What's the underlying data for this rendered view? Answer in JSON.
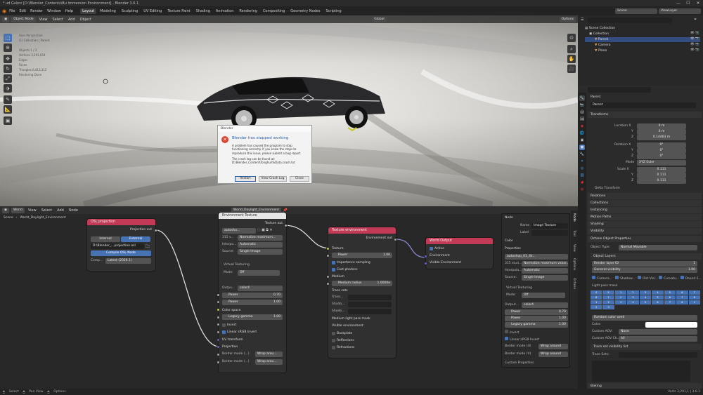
{
  "titlebar": {
    "text": "* ud Gubnr  [D:\\Blender_Contents\\Bu Immersion Environment]  -  Blender 3.6.1",
    "min": "—",
    "max": "☐",
    "close": "✕"
  },
  "menus": [
    "File",
    "Edit",
    "Render",
    "Window",
    "Help"
  ],
  "workspaces": [
    "Layout",
    "Modeling",
    "Sculpting",
    "UV Editing",
    "Texture Paint",
    "Shading",
    "Animation",
    "Rendering",
    "Compositing",
    "Geometry Nodes",
    "Scripting"
  ],
  "scene": {
    "label": "Scene",
    "viewlayer": "ViewLayer"
  },
  "viewport": {
    "mode": "Object Mode",
    "menus": [
      "View",
      "Select",
      "Add",
      "Object"
    ],
    "orientation": "Global",
    "options": "Options",
    "overlay_lines": [
      "User Perspective",
      "(1) Collection | Parent",
      "Objects   1 / 3",
      "Vertices  3,291,654",
      "Edges",
      "Faces",
      "Triangles  6,413,312",
      "Rendering Done"
    ]
  },
  "dialog": {
    "title": "Blender",
    "heading": "Blender has stopped working",
    "body": "A problem has caused the program to stop functioning correctly. If you know the steps to reproduce this issue, please submit a bug report.",
    "crash": "The crash log can be found at: D:\\Blender_Content\\Tonghui\\%Data.crash.txt",
    "restart": "Restart",
    "view": "View Crash Log",
    "close": "Close"
  },
  "node_editor": {
    "type": "World",
    "menus": [
      "View",
      "Select",
      "Add",
      "Node"
    ],
    "world_name": "World_Daylight_Environment",
    "crumb_scene": "Scene",
    "crumb_world": "World_Daylight_Environment"
  },
  "ocio": {
    "title": "OSL projection",
    "out": "Projection out",
    "internal": "Internal",
    "external": "External",
    "path": "D:\\Blender_...projection.osl",
    "compile": "Compile OSL Node",
    "comp_lbl": "Comp...",
    "comp_val": "Latest (2026.1)"
  },
  "envtex": {
    "title": "Environment Texture",
    "filename": "World_Daylight_environment",
    "out": "Texture out",
    "imgname": "autosho...",
    "colorspace_lbl": "315 s...",
    "colorspace": "Normalize maximum...",
    "interp_lbl": "Interpo...",
    "interp": "Automatic",
    "source_lbl": "Source:",
    "source": "Single Image",
    "vt": "Virtual Texturing",
    "mode_lbl": "Mode:",
    "mode": "Off",
    "output_lbl": "Outpu...",
    "output": "color4",
    "power1": "Power",
    "power1_v": "0.70",
    "power2": "Power",
    "power2_v": "1.00",
    "colorspace2": "Color space",
    "legacy": "Legacy gamma",
    "legacy_v": "1.00",
    "invert": "Invert",
    "linear": "Linear sRGB Invert",
    "uv": "UV transform",
    "proj": "Projection",
    "border1": "Border mode (...)",
    "border1_v": "Wrap arou...",
    "border2": "Border mode (...)",
    "border2_v": "Wrap arou..."
  },
  "texenv": {
    "title": "Texture environment",
    "out": "Environment out",
    "texture": "Texture",
    "power": "Power",
    "power_v": "1.00",
    "importance": "Importance sampling",
    "cast": "Cast photons",
    "medium": "Medium",
    "medium_radius": "Medium radius",
    "medium_radius_v": "1.0000e",
    "trace": "Trace sets",
    "tr1": "Trace...",
    "tr2": "Shado...",
    "tr3": "Shado...",
    "medlight": "Medium light pass mask",
    "visible": "Visible environment",
    "backplate": "Backplate",
    "reflections": "Reflections",
    "refractions": "Refractions"
  },
  "worldout": {
    "title": "World Output",
    "active": "Active",
    "env": "Environment",
    "visenv": "Visible Environment"
  },
  "npanel": {
    "node_hdr": "Node",
    "name_lbl": "Name",
    "name": "Image Texture",
    "label_lbl": "Label",
    "color_hdr": "Color",
    "props_hdr": "Properties",
    "img": "autoshop_01_4k...",
    "cs_lbl": "315 stud...",
    "cs": "Normalize maximum value...",
    "interp_lbl": "Interpola...",
    "interp": "Automatic",
    "source_lbl": "Source:",
    "source": "Single Image",
    "vt": "Virtual Texturing",
    "mode_lbl": "Mode:",
    "mode": "Off",
    "out_lbl": "Output...",
    "out": "color4",
    "p1": "Power",
    "p1v": "0.70",
    "p2": "Power",
    "p2v": "1.00",
    "lg": "Legacy gamma",
    "lgv": "1.00",
    "inv": "Invert",
    "lin": "Linear sRGB Invert",
    "bm1": "Border mode (U)",
    "bm1v": "Wrap around",
    "bm2": "Border mode (V)",
    "bm2v": "Wrap around",
    "custom": "Custom Properties"
  },
  "vtabs": [
    "Node",
    "Tool",
    "View",
    "Options",
    "Octane"
  ],
  "outliner": {
    "search": "",
    "items": [
      {
        "name": "Scene Collection",
        "indent": 0
      },
      {
        "name": "Collection",
        "indent": 1
      },
      {
        "name": "Parent",
        "indent": 2,
        "selected": true
      },
      {
        "name": "Camera",
        "indent": 2
      },
      {
        "name": "Plane",
        "indent": 2
      }
    ]
  },
  "properties": {
    "obj_name": "Parent",
    "obj_field": "Parent",
    "transforms": "Transforms",
    "loc_x": "0 m",
    "loc_y": "0 m",
    "loc_z": "0.14463 m",
    "rot_x": "0°",
    "rot_y": "0°",
    "rot_z": "0°",
    "rot_mode": "XYZ Euler",
    "scale_x": "0.111",
    "scale_y": "0.111",
    "scale_z": "0.111",
    "location": "Location X",
    "y": "Y",
    "z": "Z",
    "rotation": "Rotation X",
    "mode_lbl": "Mode",
    "scale": "Scale X",
    "delta": "Delta Transform",
    "sections": [
      "Relations",
      "Collections",
      "Instancing",
      "Motion Paths",
      "Shading",
      "Visibility"
    ],
    "octane": "Octane Object Properties",
    "obj_type_lbl": "Object Type:",
    "obj_type": "Normal Movable",
    "layers": "Object Layers",
    "render_layer": "Render layer ID",
    "render_layer_v": "1",
    "gen_vis": "General visibility",
    "gen_vis_v": "1.00",
    "checks": [
      "Camera...",
      "Shadow...",
      "Dirt Visi...",
      "Curvatu...",
      "Round E..."
    ],
    "light_pass": "Light pass mask",
    "grid": [
      "S",
      "E",
      "1",
      "2",
      "3",
      "4",
      "5",
      "6",
      "7",
      "8",
      "1",
      "2",
      "3",
      "4",
      "5",
      "6",
      "7",
      "8",
      "1",
      "2",
      "3",
      "4",
      "5",
      "6",
      "7",
      "8",
      "1",
      "2",
      "3"
    ],
    "random_seed": "Random color seed",
    "color_lbl": "Color:",
    "custom_aov": "Custom AOV:",
    "custom_aov_v": "None",
    "aov_ch": "Custom AOV Ch...:",
    "aov_ch_v": "All",
    "baking": "Baking",
    "trace_vis": "Trace set visibility list",
    "trace_sets": "Trace Sets:"
  },
  "status": {
    "s1": "Select",
    "s2": "Pan View",
    "s3": "Options",
    "version": "Verts 3,291,1 | 3.6.1"
  },
  "colors": {
    "accent": "#4772b3",
    "node_red": "#c33a56",
    "node_blue": "#3f62a6",
    "socket_yellow": "#c7c729",
    "socket_violet": "#6363c7"
  }
}
